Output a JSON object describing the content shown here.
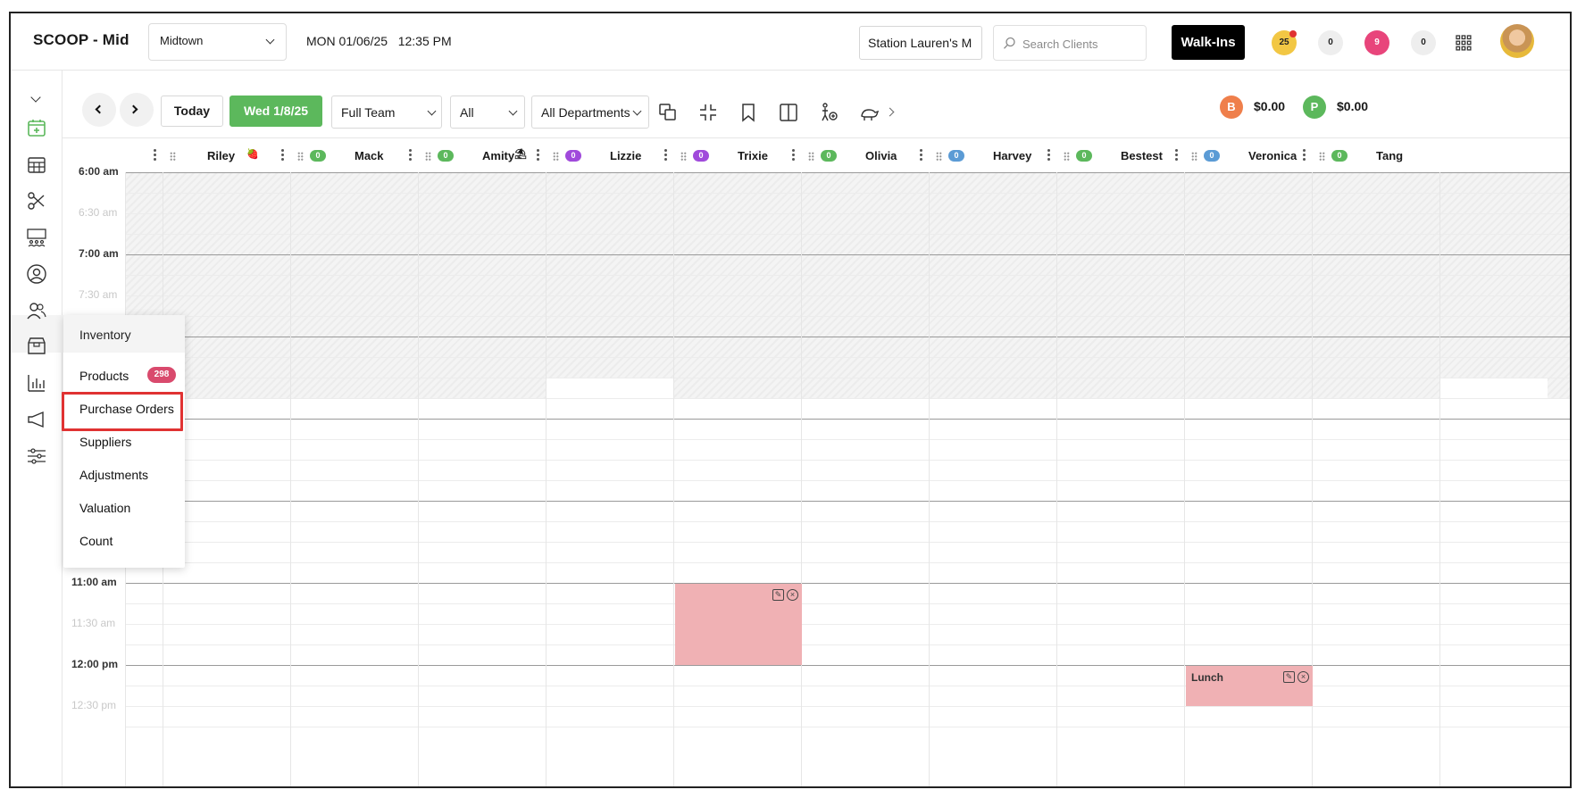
{
  "header": {
    "brand": "SCOOP - Mid",
    "location": "Midtown",
    "datetime": "MON 01/06/25   12:35 PM",
    "station": "Station Lauren's M",
    "search_placeholder": "Search Clients",
    "walkins_label": "Walk-Ins",
    "badges": [
      {
        "value": "25",
        "color": "#f2c744",
        "text_color": "#222"
      },
      {
        "value": "0",
        "color": "#eeeeee",
        "text_color": "#222"
      },
      {
        "value": "9",
        "color": "#e8457b",
        "text_color": "#ffffff"
      },
      {
        "value": "0",
        "color": "#eeeeee",
        "text_color": "#222"
      }
    ]
  },
  "toolbar": {
    "today_label": "Today",
    "date_label": "Wed 1/8/25",
    "team_select": "Full Team",
    "filter_select": "All",
    "dept_select": "All Departments",
    "totals": [
      {
        "letter": "B",
        "amount": "$0.00",
        "color": "#ef7f4b"
      },
      {
        "letter": "P",
        "amount": "$0.00",
        "color": "#5cb85c"
      }
    ]
  },
  "staff": [
    {
      "name": "Riley",
      "emoji": "🍓",
      "badge": "",
      "badge_color": ""
    },
    {
      "name": "Mack",
      "emoji": "",
      "badge": "0",
      "badge_color": "#5cb85c"
    },
    {
      "name": "Amity",
      "emoji": "⛱",
      "badge": "0",
      "badge_color": "#5cb85c"
    },
    {
      "name": "Lizzie",
      "emoji": "",
      "badge": "0",
      "badge_color": "#a04adb"
    },
    {
      "name": "Trixie",
      "emoji": "",
      "badge": "0",
      "badge_color": "#a04adb"
    },
    {
      "name": "Olivia",
      "emoji": "",
      "badge": "0",
      "badge_color": "#5cb85c"
    },
    {
      "name": "Harvey",
      "emoji": "",
      "badge": "0",
      "badge_color": "#5b9bd5"
    },
    {
      "name": "Bestest",
      "emoji": "",
      "badge": "0",
      "badge_color": "#5cb85c"
    },
    {
      "name": "Veronica",
      "emoji": "",
      "badge": "0",
      "badge_color": "#5b9bd5"
    },
    {
      "name": "Tang",
      "emoji": "",
      "badge": "0",
      "badge_color": "#5cb85c"
    }
  ],
  "times": [
    {
      "label": "6:00 am",
      "half": false
    },
    {
      "label": "6:30 am",
      "half": true
    },
    {
      "label": "7:00 am",
      "half": false
    },
    {
      "label": "7:30 am",
      "half": true
    },
    {
      "label": "11:00 am",
      "half": false
    },
    {
      "label": "11:30 am",
      "half": true
    },
    {
      "label": "12:00 pm",
      "half": false
    },
    {
      "label": "12:30 pm",
      "half": true
    }
  ],
  "appointments": [
    {
      "label": "",
      "staff": "Lizzie",
      "start": "11:00 am",
      "end": "12:00 pm"
    },
    {
      "label": "Lunch",
      "staff": "Bestest",
      "start": "12:00 pm",
      "end": "12:30 pm"
    }
  ],
  "inventory_menu": {
    "title": "Inventory",
    "items": [
      "Products",
      "Purchase Orders",
      "Suppliers",
      "Adjustments",
      "Valuation",
      "Count"
    ],
    "products_count": "298",
    "highlighted": "Purchase Orders"
  }
}
